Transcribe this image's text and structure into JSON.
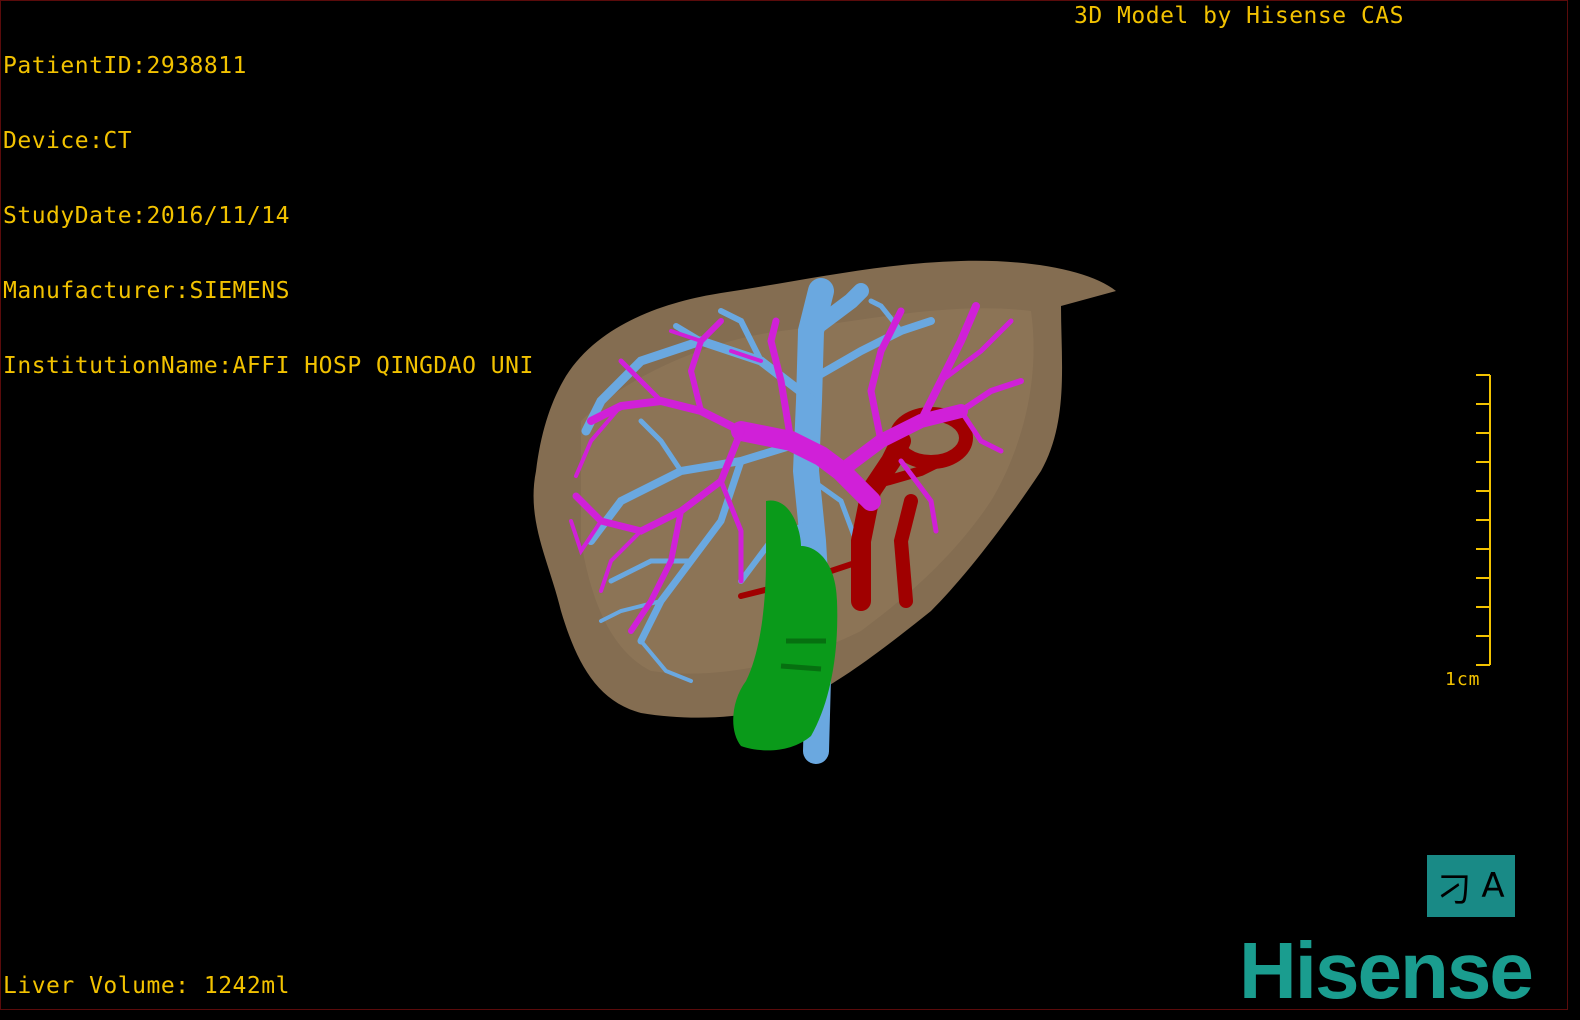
{
  "overlay": {
    "patient_line": "PatientID:2938811",
    "device_line": "Device:CT",
    "study_date_line": "StudyDate:2016/11/14",
    "manufacturer_line": "Manufacturer:SIEMENS",
    "institution_line": "InstitutionName:AFFI HOSP QINGDAO UNI",
    "model_credit": "3D Model by Hisense CAS",
    "liver_volume": "Liver Volume: 1242ml"
  },
  "scale": {
    "label": "1cm",
    "tick_count": 11
  },
  "orientation": {
    "left_glyph": "刁",
    "right_glyph": "A"
  },
  "brand": {
    "logo_text": "Hisense"
  },
  "colors": {
    "overlay_text": "#f2c200",
    "liver": "#8b7355",
    "hepatic_vein": "#6aa8e0",
    "portal_vein": "#d020d8",
    "artery": "#a00000",
    "tumor": "#0a9a1a",
    "brand": "#1a9d8f"
  },
  "structures": [
    "liver",
    "hepatic-vein",
    "portal-vein",
    "artery",
    "tumor"
  ]
}
